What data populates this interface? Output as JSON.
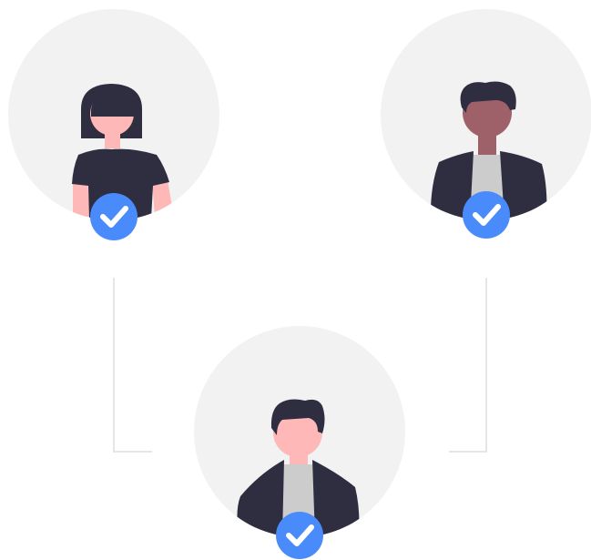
{
  "colors": {
    "avatar_bg": "#f2f2f2",
    "connector": "#e6e6e6",
    "hair": "#2f2e41",
    "skin_light": "#ffb8b8",
    "skin_dark": "#9e616a",
    "clothing_dark": "#2f2e41",
    "shirt_gray": "#cccccc",
    "badge_blue": "#4a8bfc",
    "check_white": "#ffffff"
  },
  "nodes": [
    {
      "id": "woman",
      "figure": "woman",
      "skin": "skin_light",
      "verified": true,
      "badge_icon": "check-icon"
    },
    {
      "id": "man-dark",
      "figure": "man",
      "skin": "skin_dark",
      "verified": true,
      "badge_icon": "check-icon"
    },
    {
      "id": "man-light",
      "figure": "man",
      "skin": "skin_light",
      "verified": true,
      "badge_icon": "check-icon"
    }
  ],
  "connections": [
    {
      "from": "woman",
      "to": "man-light"
    },
    {
      "from": "man-dark",
      "to": "man-light"
    }
  ]
}
